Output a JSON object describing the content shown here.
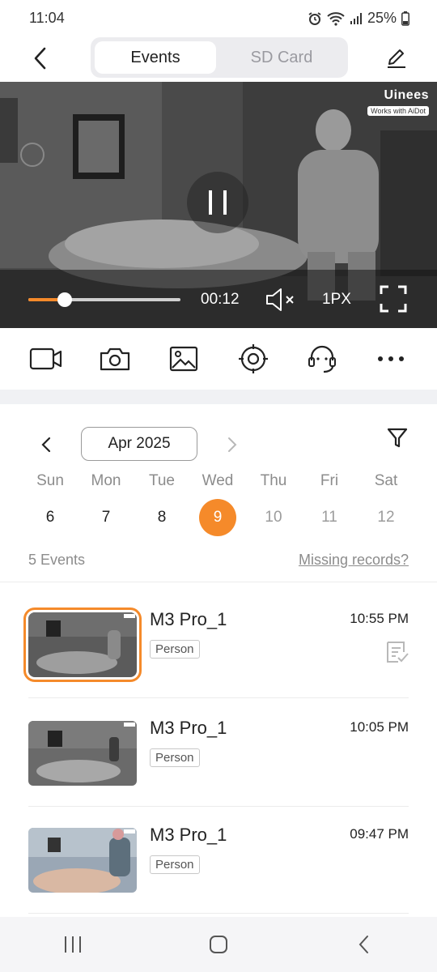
{
  "status_bar": {
    "time": "11:04",
    "battery": "25%"
  },
  "header": {
    "tabs": [
      "Events",
      "SD Card"
    ],
    "active_tab": "Events"
  },
  "player": {
    "brand": "Uinees",
    "brand_badge": "Works with AiDot",
    "elapsed": "00:12",
    "progress": 0.24,
    "quality": "1PX",
    "muted": true
  },
  "toolbar": {
    "icons": [
      "video-record-icon",
      "camera-snapshot-icon",
      "gallery-icon",
      "ptz-target-icon",
      "talk-headset-icon",
      "more-icon"
    ]
  },
  "calendar": {
    "month_label": "Apr 2025",
    "weekdays": [
      "Sun",
      "Mon",
      "Tue",
      "Wed",
      "Thu",
      "Fri",
      "Sat"
    ],
    "days": [
      "6",
      "7",
      "8",
      "9",
      "10",
      "11",
      "12"
    ],
    "selected_day": "9",
    "accent": "#f58a2a"
  },
  "events_summary": {
    "count": "5 Events",
    "missing_link": "Missing records?"
  },
  "events": [
    {
      "device": "M3 Pro_1",
      "tag": "Person",
      "time": "10:55 PM",
      "selected": true
    },
    {
      "device": "M3 Pro_1",
      "tag": "Person",
      "time": "10:05 PM",
      "selected": false
    },
    {
      "device": "M3 Pro_1",
      "tag": "Person",
      "time": "09:47 PM",
      "selected": false
    }
  ]
}
